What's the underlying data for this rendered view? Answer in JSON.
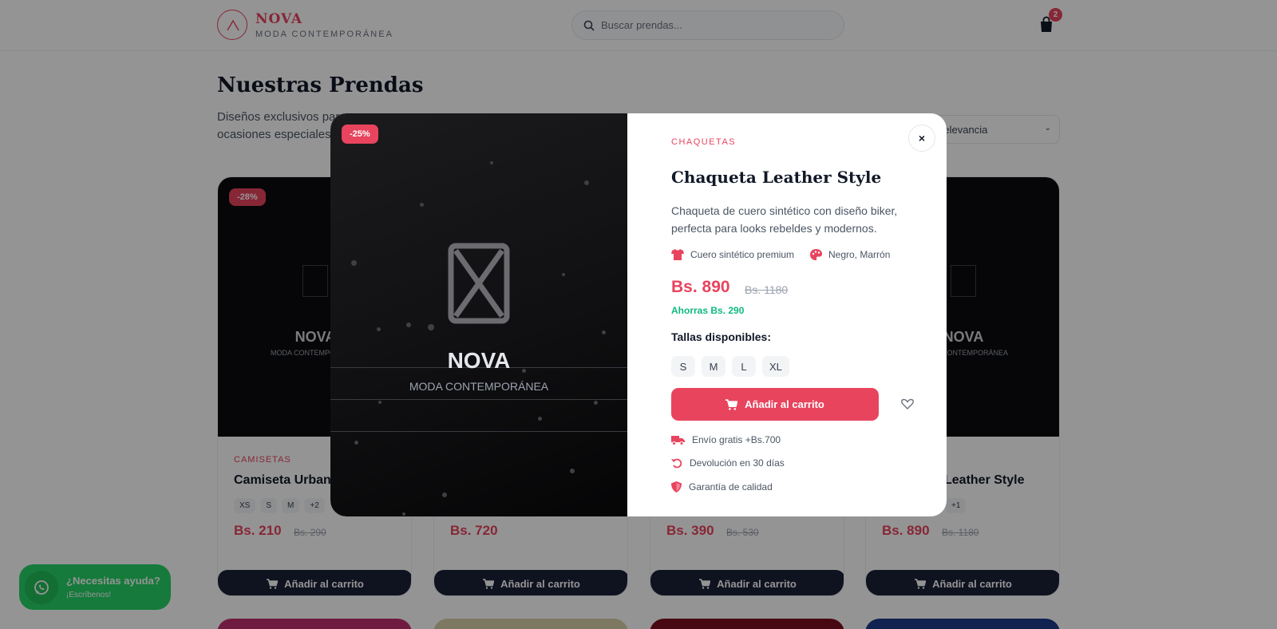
{
  "header": {
    "logo_title": "NOVA",
    "logo_sub": "MODA CONTEMPORÁNEA",
    "search_placeholder": "Buscar prendas...",
    "cart_count": "2"
  },
  "page": {
    "title": "Nuestras Prendas",
    "subtitle": "Diseños exclusivos para ocasiones especiales",
    "sort_value": "Relevancia"
  },
  "products": [
    {
      "badge": "-28%",
      "category": "CAMISETAS",
      "name": "Camiseta Urban",
      "sizes": [
        "XS",
        "S",
        "M",
        "+2"
      ],
      "price": "Bs. 210",
      "old_price": "Bs. 290",
      "brand": "NOVA",
      "brand_sub": "MODA CONTEMPORÁNEA",
      "button": "Añadir al carrito"
    },
    {
      "price": "Bs. 720",
      "button": "Añadir al carrito"
    },
    {
      "price": "Bs. 390",
      "old_price": "Bs. 530",
      "button": "Añadir al carrito"
    },
    {
      "name": "Leather Style",
      "sizes": [
        "+1"
      ],
      "price": "Bs. 890",
      "old_price": "Bs. 1180",
      "brand": "NOVA",
      "brand_sub": "MODA CONTEMPORÁNEA",
      "button": "Añadir al carrito"
    }
  ],
  "whatsapp": {
    "title": "¿Necesitas ayuda?",
    "subtitle": "¡Escríbenos!"
  },
  "modal": {
    "badge": "-25%",
    "brand": "NOVA",
    "brand_sub": "MODA CONTEMPORÁNEA",
    "category": "CHAQUETAS",
    "title": "Chaqueta Leather Style",
    "description": "Chaqueta de cuero sintético con diseño biker, perfecta para looks rebeldes y modernos.",
    "material": "Cuero sintético premium",
    "colors": "Negro, Marrón",
    "price": "Bs. 890",
    "old_price": "Bs. 1180",
    "savings": "Ahorras Bs. 290",
    "sizes_title": "Tallas disponibles:",
    "sizes": [
      "S",
      "M",
      "L",
      "XL"
    ],
    "add_button": "Añadir al carrito",
    "close_label": "×",
    "benefits": [
      "Envío gratis +Bs.700",
      "Devolución en 30 días",
      "Garantía de calidad"
    ]
  },
  "colors": {
    "accent": "#e8445e",
    "dark_button": "#1a1f36",
    "savings": "#10b981",
    "whatsapp": "#25d366"
  },
  "icons": [
    "shopping-bag-icon",
    "search-icon",
    "shirt-icon",
    "palette-icon",
    "cart-icon",
    "heart-icon",
    "truck-icon",
    "return-icon",
    "shield-icon",
    "whatsapp-icon",
    "close-icon",
    "chevron-down-icon"
  ]
}
